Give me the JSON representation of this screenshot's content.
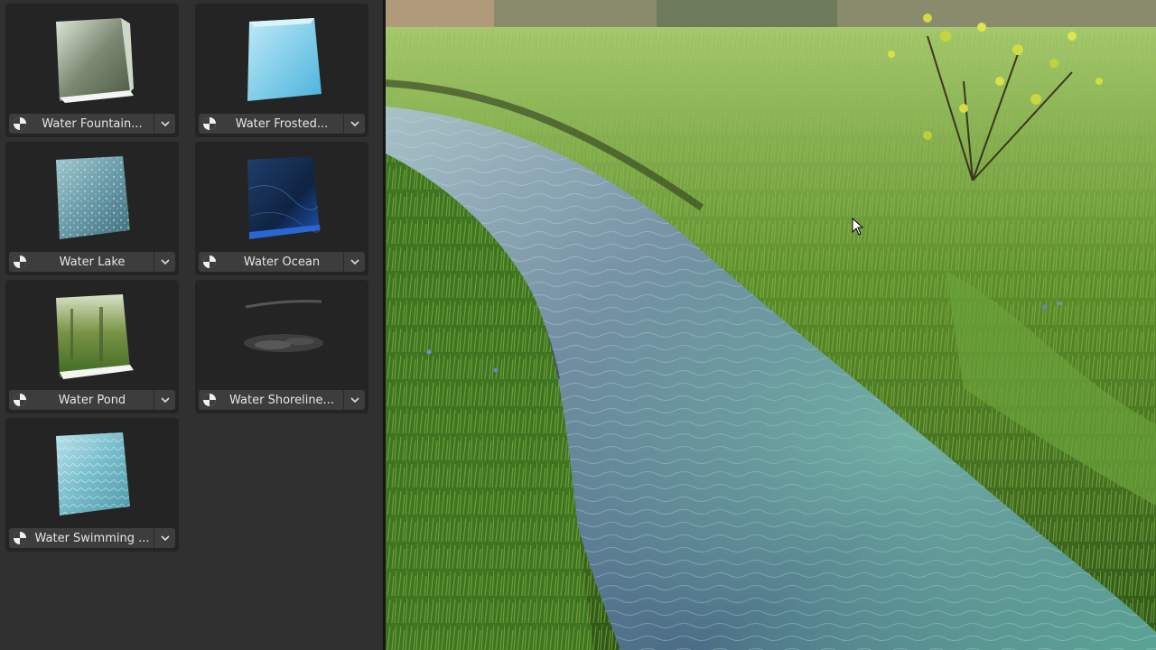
{
  "materials": [
    {
      "label": "Water Fountain...",
      "icon": "material-sphere-icon",
      "preview": "fountain"
    },
    {
      "label": "Water Frosted...",
      "icon": "material-sphere-icon",
      "preview": "frosted"
    },
    {
      "label": "Water Lake",
      "icon": "material-sphere-icon",
      "preview": "lake"
    },
    {
      "label": "Water Ocean",
      "icon": "material-sphere-icon",
      "preview": "ocean"
    },
    {
      "label": "Water Pond",
      "icon": "material-sphere-icon",
      "preview": "pond"
    },
    {
      "label": "Water Shoreline...",
      "icon": "material-sphere-icon",
      "preview": "shoreline"
    },
    {
      "label": "Water Swimming ...",
      "icon": "material-sphere-icon",
      "preview": "swimming"
    }
  ],
  "viewport": {
    "scene": "stream through grassy meadow",
    "cursor_icon": "arrow-cursor-icon"
  },
  "colors": {
    "panel_bg": "#303030",
    "card_bg": "#242424",
    "bar_bg": "#3d3d3d",
    "label_text": "#e6e6e6"
  }
}
